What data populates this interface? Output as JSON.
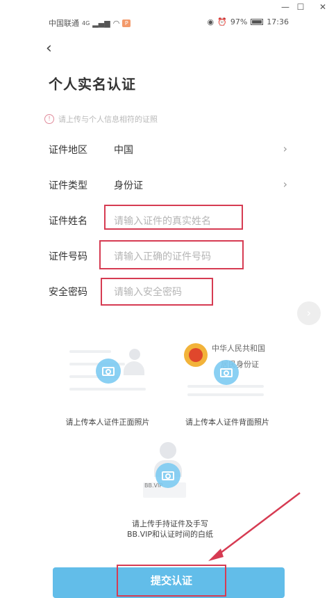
{
  "window": {
    "minimize": "—",
    "maximize": "☐",
    "close": "✕"
  },
  "status": {
    "carrier": "中国联通",
    "network": "4G",
    "battery": "97%",
    "time": "17:36",
    "battery_level": 0.97
  },
  "header": {
    "back": "‹",
    "title": "个人实名认证"
  },
  "notice": {
    "icon": "!",
    "text": "请上传与个人信息相符的证照"
  },
  "form": {
    "region": {
      "label": "证件地区",
      "value": "中国"
    },
    "type": {
      "label": "证件类型",
      "value": "身份证"
    },
    "name": {
      "label": "证件姓名",
      "placeholder": "请输入证件的真实姓名"
    },
    "number": {
      "label": "证件号码",
      "placeholder": "请输入正确的证件号码"
    },
    "password": {
      "label": "安全密码",
      "placeholder": "请输入安全密码"
    },
    "chevron": "›"
  },
  "uploads": {
    "front_caption": "请上传本人证件正面照片",
    "back_caption": "请上传本人证件背面照片",
    "back_card_title_1": "中华人民共和国",
    "back_card_title_2": "居民身份证",
    "handheld_caption_1": "请上传手持证件及手写",
    "handheld_caption_2": "BB.VIP和认证时间的白纸",
    "paper_text": "BB.VIP"
  },
  "submit": {
    "label": "提交认证"
  },
  "colors": {
    "accent": "#62bde9",
    "highlight": "#d63b52",
    "camera": "#7ecbf2"
  }
}
